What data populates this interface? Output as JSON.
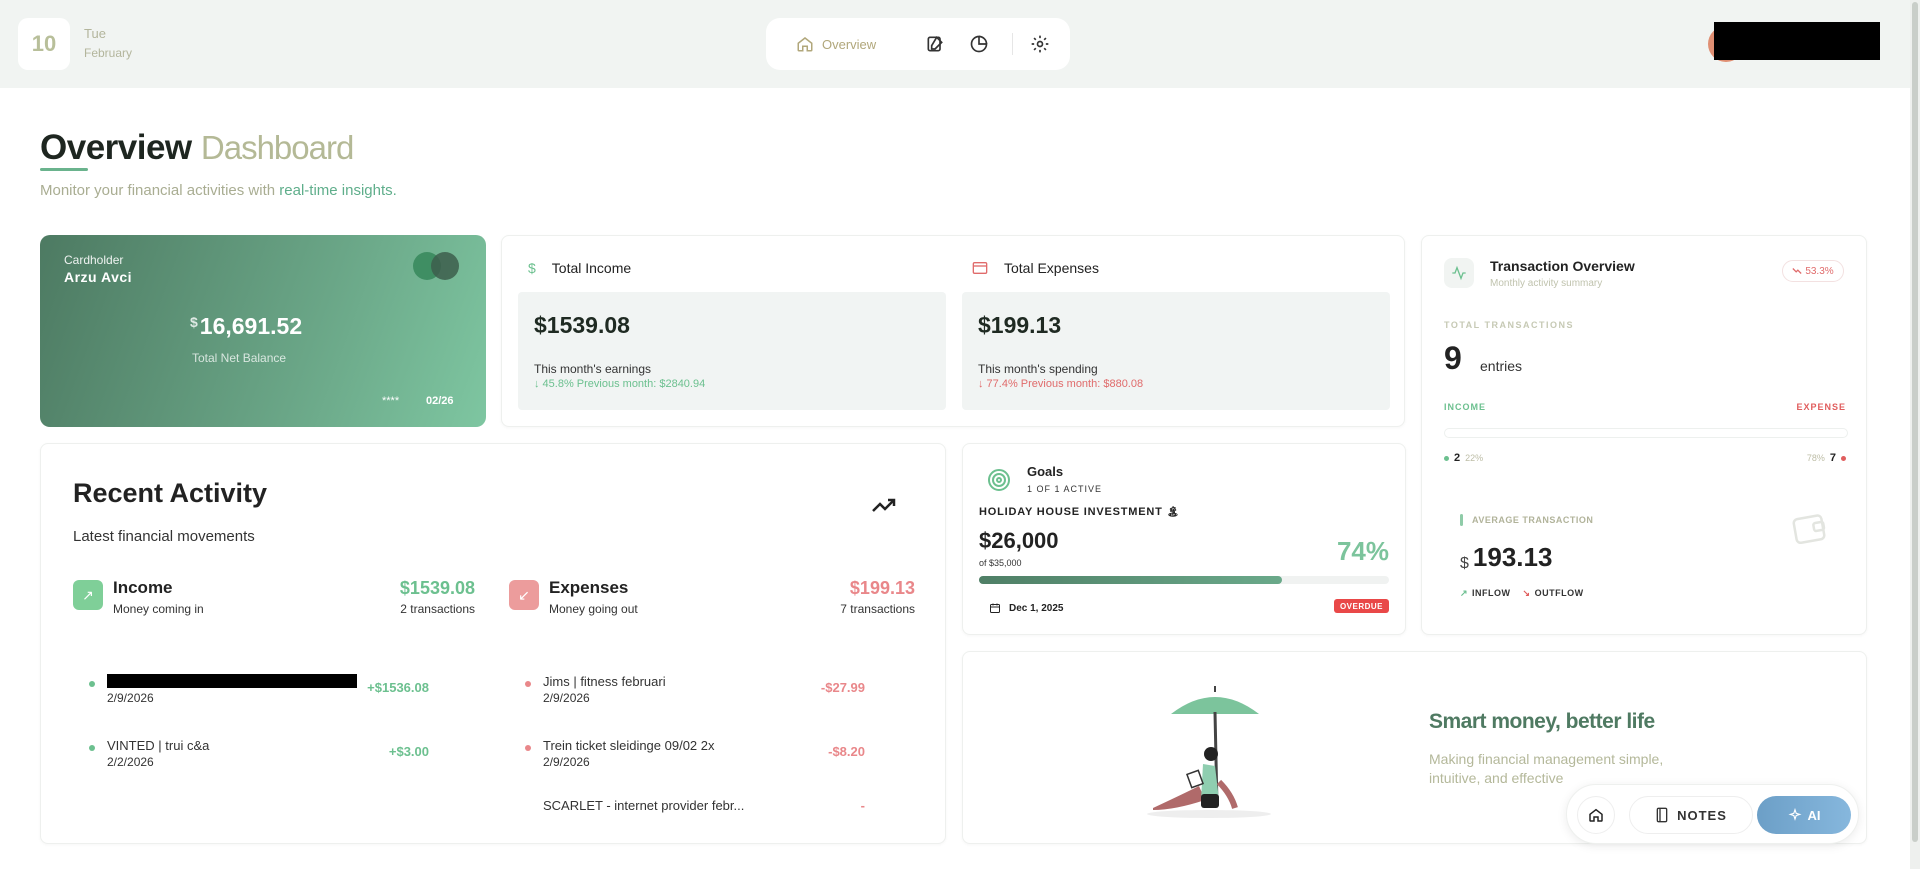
{
  "header": {
    "date_number": "10",
    "day_name": "Tue",
    "month_name": "February",
    "nav": {
      "overview_label": "Overview"
    }
  },
  "page": {
    "title": "Overview",
    "title_sub": "Dashboard",
    "subtitle_prefix": "Monitor your financial activities with ",
    "subtitle_highlight": "real-time insights."
  },
  "card": {
    "holder_label": "Cardholder",
    "holder_name": "Arzu Avci",
    "currency": "$",
    "balance": "16,691.52",
    "balance_label": "Total Net Balance",
    "masked": "****",
    "expiry": "02/26"
  },
  "income": {
    "title": "Total Income",
    "amount": "$1539.08",
    "label": "This month's earnings",
    "change": "↓ 45.8% Previous month: $2840.94"
  },
  "expenses": {
    "title": "Total Expenses",
    "amount": "$199.13",
    "label": "This month's spending",
    "change": "↓ 77.4% Previous month: $880.08"
  },
  "tx_overview": {
    "title": "Transaction Overview",
    "subtitle": "Monthly activity summary",
    "badge": "53.3%",
    "total_label": "TOTAL TRANSACTIONS",
    "total_count": "9",
    "entries_label": "entries",
    "income_label": "INCOME",
    "expense_label": "EXPENSE",
    "income_count": "2",
    "income_pct": "22%",
    "expense_count": "7",
    "expense_pct": "78%",
    "avg_label": "AVERAGE TRANSACTION",
    "avg_currency": "$",
    "avg_value": "193.13",
    "inflow_label": "INFLOW",
    "outflow_label": "OUTFLOW"
  },
  "recent": {
    "title": "Recent Activity",
    "subtitle": "Latest financial movements",
    "income_col": {
      "title": "Income",
      "subtitle": "Money coming in",
      "amount": "$1539.08",
      "count": "2 transactions"
    },
    "expense_col": {
      "title": "Expenses",
      "subtitle": "Money going out",
      "amount": "$199.13",
      "count": "7 transactions"
    },
    "income_rows": [
      {
        "name": "",
        "date": "2/9/2026",
        "amount": "+$1536.08"
      },
      {
        "name": "VINTED | trui c&a",
        "date": "2/2/2026",
        "amount": "+$3.00"
      }
    ],
    "expense_rows": [
      {
        "name": "Jims | fitness februari",
        "date": "2/9/2026",
        "amount": "-$27.99"
      },
      {
        "name": "Trein ticket sleidinge 09/02 2x",
        "date": "2/9/2026",
        "amount": "-$8.20"
      },
      {
        "name": "SCARLET - internet provider febr...",
        "date": "",
        "amount": "-"
      }
    ]
  },
  "goals": {
    "title": "Goals",
    "subtitle": "1 OF 1 ACTIVE",
    "goal_name": "HOLIDAY HOUSE INVESTMENT",
    "goal_emoji": "🏝",
    "value": "$26,000",
    "target": "of $35,000",
    "percent": "74%",
    "progress": 0.74,
    "due_date": "Dec 1, 2025",
    "status": "OVERDUE"
  },
  "promo": {
    "title": "Smart money, better life",
    "description": "Making financial management simple, intuitive, and effective"
  },
  "dock": {
    "notes_label": "NOTES",
    "ai_label": "AI"
  },
  "colors": {
    "accent_green": "#6ab38d",
    "income_green": "#6cc08f",
    "expense_red": "#e05d5d",
    "ai_blue": "#7aaed6"
  }
}
